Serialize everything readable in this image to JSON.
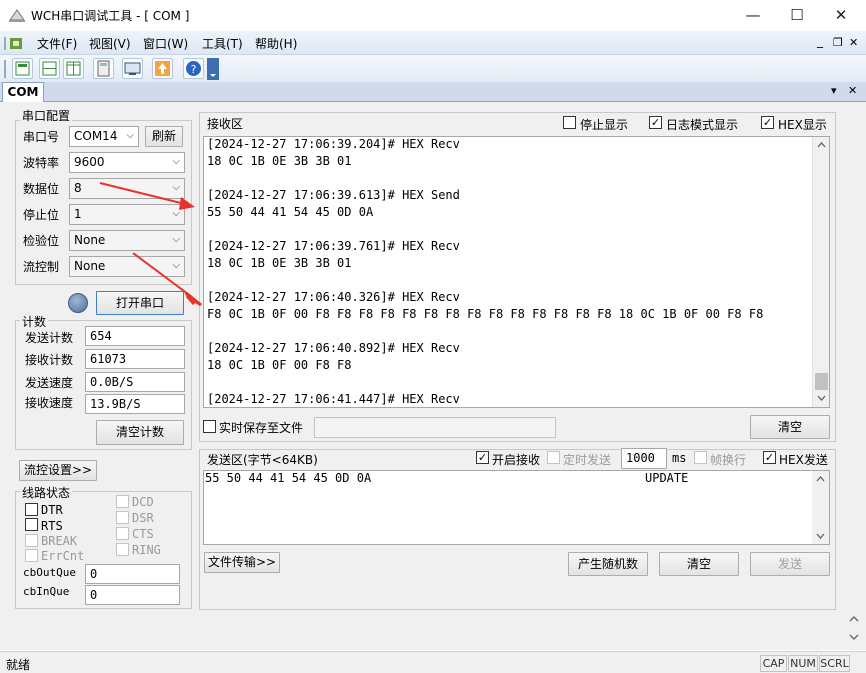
{
  "window": {
    "title": "WCH串口调试工具 - [ COM ]",
    "minimize": "—",
    "maximize": "☐",
    "close": "✕"
  },
  "menu": [
    "文件(F)",
    "视图(V)",
    "窗口(W)",
    "工具(T)",
    "帮助(H)"
  ],
  "mdi_controls": {
    "minimize": "_",
    "restore": "❐",
    "close": "✕"
  },
  "tab": {
    "label": "COM",
    "menu_glyph": "▾",
    "close_glyph": "✕"
  },
  "serial_config": {
    "title": "串口配置",
    "port_label": "串口号",
    "port_value": "COM14",
    "refresh": "刷新",
    "baud_label": "波特率",
    "baud_value": "9600",
    "data_bits_label": "数据位",
    "data_bits_value": "8",
    "stop_bits_label": "停止位",
    "stop_bits_value": "1",
    "parity_label": "检验位",
    "parity_value": "None",
    "flow_label": "流控制",
    "flow_value": "None",
    "open_port": "打开串口"
  },
  "counter": {
    "title": "计数",
    "send_count_label": "发送计数",
    "send_count": "654",
    "recv_count_label": "接收计数",
    "recv_count": "61073",
    "send_speed_label": "发送速度",
    "send_speed": "0.0B/S",
    "recv_speed_label": "接收速度",
    "recv_speed": "13.9B/S",
    "clear": "清空计数"
  },
  "flow_settings": "流控设置>>",
  "line_status": {
    "title": "线路状态",
    "dtr": "DTR",
    "rts": "RTS",
    "break": "BREAK",
    "errcnt": "ErrCnt",
    "dcd": "DCD",
    "dsr": "DSR",
    "cts": "CTS",
    "ring": "RING",
    "cb_out_label": "cbOutQue",
    "cb_out": "0",
    "cb_in_label": "cbInQue",
    "cb_in": "0"
  },
  "receive": {
    "title": "接收区",
    "stop_display": "停止显示",
    "log_mode": "日志模式显示",
    "hex_display": "HEX显示",
    "lines": [
      "[2024-12-27 17:06:39.204]# HEX Recv",
      "18 0C 1B 0E 3B 3B 01",
      "",
      "[2024-12-27 17:06:39.613]# HEX Send",
      "55 50 44 41 54 45 0D 0A",
      "",
      "[2024-12-27 17:06:39.761]# HEX Recv",
      "18 0C 1B 0E 3B 3B 01",
      "",
      "[2024-12-27 17:06:40.326]# HEX Recv",
      "F8 0C 1B 0F 00 F8 F8 F8 F8 F8 F8 F8 F8 F8 F8 F8 F8 F8 F8 18 0C 1B 0F 00 F8 F8",
      "",
      "[2024-12-27 17:06:40.892]# HEX Recv",
      "18 0C 1B 0F 00 F8 F8",
      "",
      "[2024-12-27 17:06:41.447]# HEX Recv"
    ],
    "save_realtime": "实时保存至文件",
    "clear": "清空"
  },
  "send": {
    "title": "发送区(字节<64KB)",
    "enable_recv": "开启接收",
    "timed_send": "定时发送",
    "interval": "1000",
    "interval_unit": "ms",
    "frame_newline": "帧换行",
    "hex_send": "HEX发送",
    "content_hex": "55 50 44 41 54 45 0D 0A",
    "content_text": "UPDATE",
    "file_transfer": "文件传输>>",
    "random": "产生随机数",
    "clear": "清空",
    "send": "发送"
  },
  "status_bar": {
    "text": "就绪",
    "cap": "CAP",
    "num": "NUM",
    "scrl": "SCRL"
  },
  "colors": {
    "arrow": "#e8322a",
    "tab_strip": "#cfdbec",
    "panel": "#f0f0f0"
  }
}
